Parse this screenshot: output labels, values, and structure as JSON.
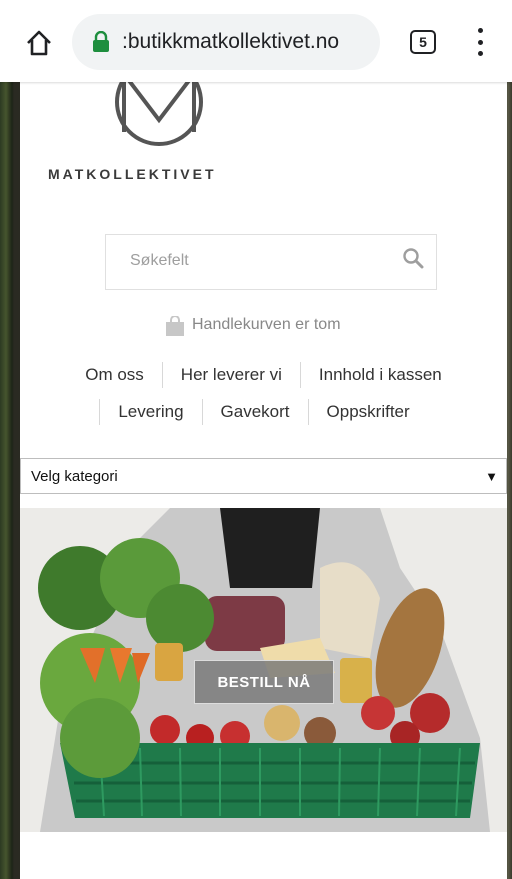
{
  "browser": {
    "url": ":butikkmatkollektivet.no",
    "tab_count": "5"
  },
  "site": {
    "brand": "MATKOLLEKTIVET",
    "search_placeholder": "Søkefelt",
    "cart_text": "Handlekurven er tom"
  },
  "nav": {
    "row1": [
      "Om oss",
      "Her leverer vi",
      "Innhold i kassen"
    ],
    "row2": [
      "Levering",
      "Gavekort",
      "Oppskrifter"
    ]
  },
  "category": {
    "selected": "Velg kategori",
    "arrow": "▼"
  },
  "hero": {
    "cta_label": "BESTILL NÅ"
  },
  "colors": {
    "lock_green": "#1e8e3e",
    "crate_green": "#1f7a4a",
    "cta_bg": "#7a7a7a"
  }
}
